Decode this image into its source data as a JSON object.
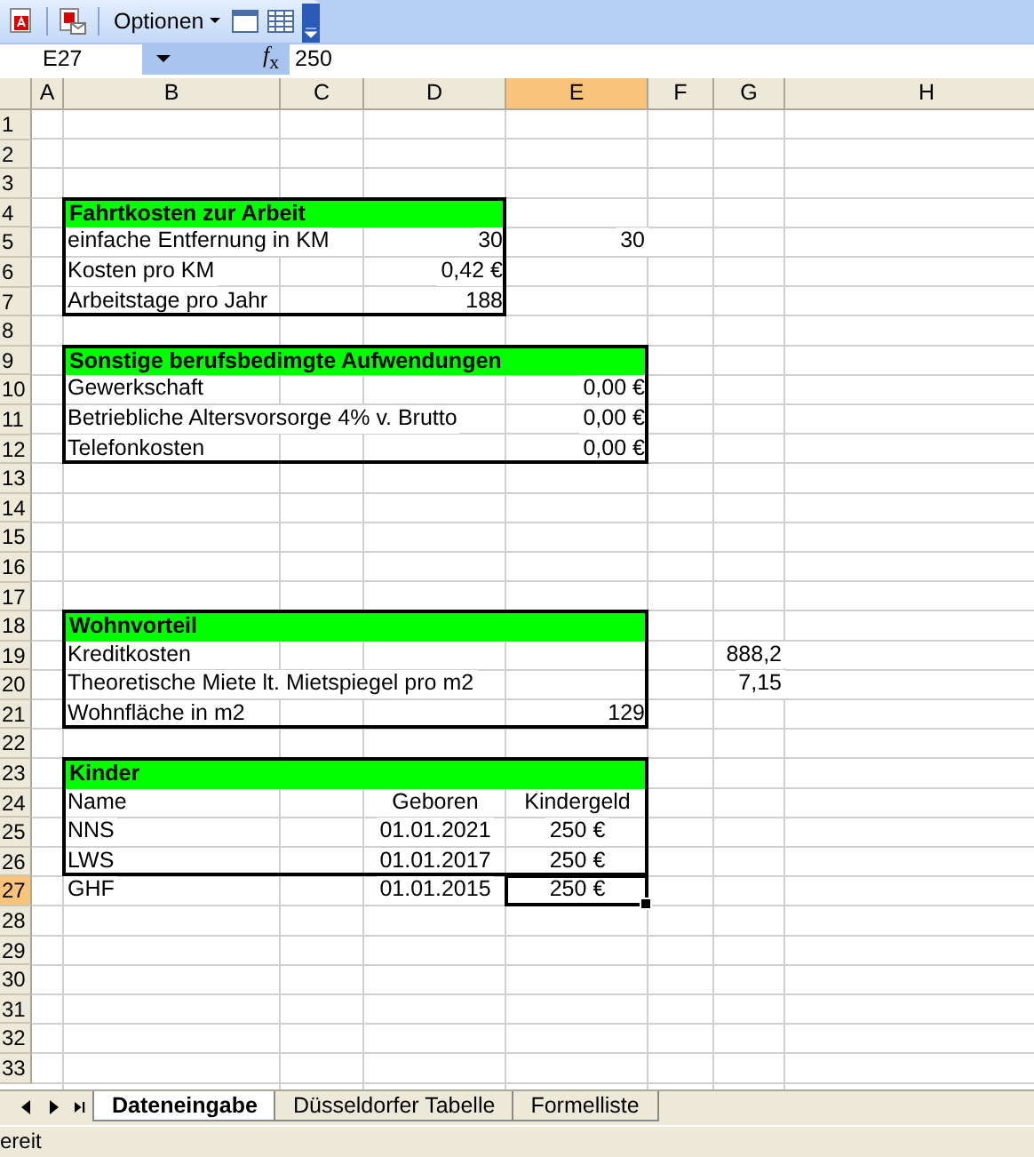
{
  "toolbar": {
    "options_menu": "Optionen"
  },
  "formula_bar": {
    "name_box": "E27",
    "function_button": "*f*$_{x}$",
    "formula": "250"
  },
  "columns": [
    {
      "label": "A",
      "selected": false
    },
    {
      "label": "B",
      "selected": false
    },
    {
      "label": "C",
      "selected": false
    },
    {
      "label": "D",
      "selected": false
    },
    {
      "label": "E",
      "selected": true
    },
    {
      "label": "F",
      "selected": false
    },
    {
      "label": "G",
      "selected": false
    },
    {
      "label": "H",
      "selected": false
    }
  ],
  "rows": [
    {
      "label": "1",
      "selected": false,
      "outlined": false,
      "cells": {}
    },
    {
      "label": "2",
      "selected": false,
      "outlined": false,
      "cells": {}
    },
    {
      "label": "3",
      "selected": false,
      "outlined": false,
      "cells": {}
    },
    {
      "label": "4",
      "selected": false,
      "outlined": true,
      "cells": {
        "B": {
          "kind": "heading",
          "wide": false,
          "text": "Fahrtkosten zur Arbeit"
        }
      }
    },
    {
      "label": "5",
      "selected": false,
      "outlined": true,
      "cells": {
        "B": {
          "kind": "label",
          "text": "einfache Entfernung in KM"
        },
        "D": {
          "kind": "number",
          "text": "30"
        },
        "E": {
          "kind": "number",
          "text": "30"
        }
      }
    },
    {
      "label": "6",
      "selected": false,
      "outlined": true,
      "cells": {
        "B": {
          "kind": "label",
          "text": "Kosten pro KM"
        },
        "D": {
          "kind": "number",
          "text": "0,42 €"
        }
      }
    },
    {
      "label": "7",
      "selected": false,
      "outlined": true,
      "cells": {
        "B": {
          "kind": "label",
          "text": "Arbeitstage pro Jahr"
        },
        "D": {
          "kind": "number",
          "text": "188"
        }
      }
    },
    {
      "label": "8",
      "selected": false,
      "outlined": false,
      "cells": {}
    },
    {
      "label": "9",
      "selected": false,
      "outlined": true,
      "cells": {
        "B": {
          "kind": "heading",
          "wide": true,
          "text": "Sonstige berufsbedimgte Aufwendungen"
        }
      }
    },
    {
      "label": "10",
      "selected": false,
      "outlined": true,
      "cells": {
        "B": {
          "kind": "label",
          "text": "Gewerkschaft"
        },
        "E": {
          "kind": "number",
          "text": "0,00 €"
        }
      }
    },
    {
      "label": "11",
      "selected": false,
      "outlined": true,
      "cells": {
        "B": {
          "kind": "label",
          "text": "Betriebliche Altersvorsorge 4% v. Brutto"
        },
        "E": {
          "kind": "number",
          "text": "0,00 €"
        }
      }
    },
    {
      "label": "12",
      "selected": false,
      "outlined": true,
      "cells": {
        "B": {
          "kind": "label",
          "text": "Telefonkosten"
        },
        "E": {
          "kind": "number",
          "text": "0,00 €"
        }
      }
    },
    {
      "label": "13",
      "selected": false,
      "outlined": false,
      "cells": {}
    },
    {
      "label": "14",
      "selected": false,
      "outlined": false,
      "cells": {}
    },
    {
      "label": "15",
      "selected": false,
      "outlined": false,
      "cells": {}
    },
    {
      "label": "16",
      "selected": false,
      "outlined": false,
      "cells": {}
    },
    {
      "label": "17",
      "selected": false,
      "outlined": false,
      "cells": {}
    },
    {
      "label": "18",
      "selected": false,
      "outlined": true,
      "cells": {
        "B": {
          "kind": "heading",
          "wide": true,
          "text": "Wohnvorteil"
        }
      }
    },
    {
      "label": "19",
      "selected": false,
      "outlined": true,
      "cells": {
        "B": {
          "kind": "label",
          "text": "Kreditkosten"
        },
        "G": {
          "kind": "number",
          "text": "888,2"
        }
      }
    },
    {
      "label": "20",
      "selected": false,
      "outlined": true,
      "cells": {
        "B": {
          "kind": "label",
          "text": "Theoretische Miete lt. Mietspiegel pro m2"
        },
        "G": {
          "kind": "number",
          "text": "7,15"
        }
      }
    },
    {
      "label": "21",
      "selected": false,
      "outlined": true,
      "cells": {
        "B": {
          "kind": "label",
          "text": "Wohnfläche in m2"
        },
        "E": {
          "kind": "number",
          "text": "129"
        }
      }
    },
    {
      "label": "22",
      "selected": false,
      "outlined": false,
      "cells": {}
    },
    {
      "label": "23",
      "selected": false,
      "outlined": true,
      "cells": {
        "B": {
          "kind": "heading",
          "wide": true,
          "text": "Kinder"
        }
      }
    },
    {
      "label": "24",
      "selected": false,
      "outlined": true,
      "cells": {
        "B": {
          "kind": "label",
          "text": "Name"
        },
        "D": {
          "kind": "centered",
          "text": "Geboren"
        },
        "E": {
          "kind": "centered",
          "text": "Kindergeld"
        }
      }
    },
    {
      "label": "25",
      "selected": false,
      "outlined": true,
      "cells": {
        "B": {
          "kind": "label",
          "text": "NNS"
        },
        "D": {
          "kind": "centered",
          "text": "01.01.2021"
        },
        "E": {
          "kind": "centered",
          "text": "250 €"
        }
      }
    },
    {
      "label": "26",
      "selected": false,
      "outlined": true,
      "cells": {
        "B": {
          "kind": "label",
          "text": "LWS"
        },
        "D": {
          "kind": "centered",
          "text": "01.01.2017"
        },
        "E": {
          "kind": "centered",
          "text": "250 €"
        }
      }
    },
    {
      "label": "27",
      "selected": true,
      "outlined": false,
      "cells": {
        "B": {
          "kind": "label",
          "text": "GHF"
        },
        "D": {
          "kind": "centered",
          "text": "01.01.2015"
        },
        "E": {
          "kind": "centered",
          "text": "250 €"
        }
      }
    },
    {
      "label": "28",
      "selected": false,
      "outlined": false,
      "cells": {}
    },
    {
      "label": "29",
      "selected": false,
      "outlined": false,
      "cells": {}
    },
    {
      "label": "30",
      "selected": false,
      "outlined": false,
      "cells": {}
    },
    {
      "label": "31",
      "selected": false,
      "outlined": false,
      "cells": {}
    },
    {
      "label": "32",
      "selected": false,
      "outlined": false,
      "cells": {}
    },
    {
      "label": "33",
      "selected": false,
      "outlined": false,
      "cells": {}
    }
  ],
  "sheet_tabs": [
    {
      "label": "Dateneingabe",
      "selected": true
    },
    {
      "label": "Düsseldorfer Tabelle",
      "selected": false
    },
    {
      "label": "Formelliste",
      "selected": false
    }
  ],
  "status_bar": {
    "text": "ereit"
  }
}
